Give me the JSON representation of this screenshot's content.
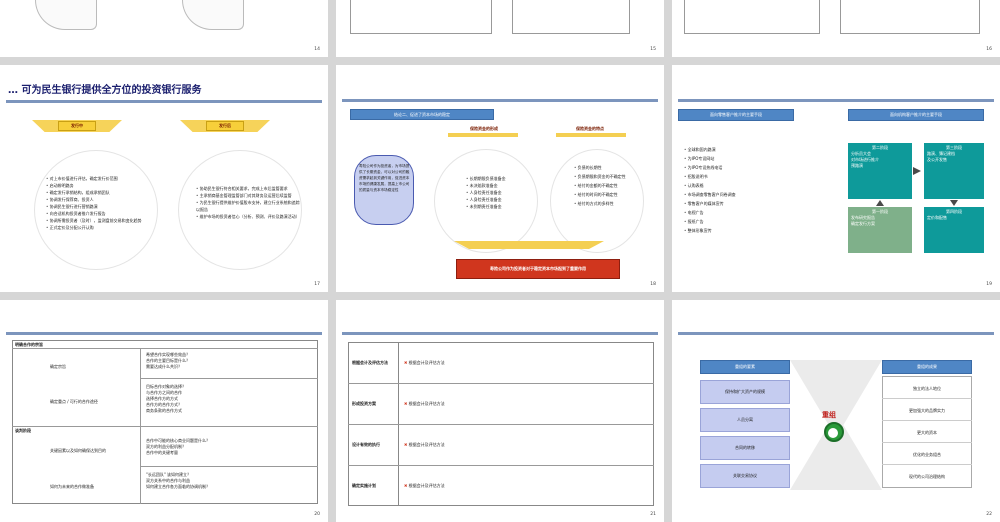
{
  "slides": {
    "s14": {
      "page": "14"
    },
    "s15": {
      "page": "15"
    },
    "s16": {
      "page": "16"
    },
    "s17": {
      "page": "17",
      "title": "… 可为民生银行提供全方位的投资银行服务",
      "stage_left": "发行中",
      "stage_right": "发行后",
      "left_items": [
        "对上市价值进行评估，确定发行价范围",
        "启动辨明路务",
        "确定发行承销结构，组成承销团队",
        "协调发行保荐商、投资人",
        "协调民生银行进行营销路演",
        "向合适机构投资者推介发行报告",
        "协调所需投资者（及时），监测盘前交易和变化趋势",
        "正式定价及分配公开认购"
      ],
      "right_items": [
        "协助民生银行符合相关要求，完成上市后监管要求",
        "主承销商基金管理监管部门对其财务及运营后续监管",
        "为民生银行提供维护价值股市支持，建立行业系统和追踪以报告",
        "维护市场的投资者信心（分析、预测、评价及路演活动）"
      ]
    },
    "s18": {
      "page": "18",
      "header": "结论二、促进了资本市场的稳定",
      "callout": "寿险公司作为投资者，为市场提供了长期资金，可以对公司的融资需求起到关键作用，促进资本市场的健康发展，提高上市公司的质量与资本市场稳定性",
      "left_head": "保险资金的形成",
      "right_head": "保险资金的特点",
      "left_items": [
        "长期期限负债准备金",
        "未决赔款准备金",
        "人身险责任准备金",
        "人身险责任准备金",
        "未到期责任准备金"
      ],
      "right_items": [
        "负债的长期性",
        "负债期限和资金的不确定性",
        "给付的金额的不确定性",
        "给付的时间的不确定性",
        "给付的方式的多样性"
      ],
      "bottom": "寿险公司作为投资者对于稳定资本市场起到了重要作用"
    },
    "s19": {
      "page": "19",
      "head_left": "面向零售客户推介的主要手段",
      "head_right": "面向机构客户推介的主要手段",
      "list": [
        "全球和国内路演",
        "为IPO专设网站",
        "为IPO专设热线电话",
        "招股说明书",
        "认购表格",
        "市场调查零售客户问卷调查",
        "零售客户的媒体宣传",
        "电视广告",
        "报纸广告",
        "整体形象宣传"
      ],
      "phases": [
        {
          "label": "第二阶段",
          "items": [
            "分析员大会",
            "对市场进行推介",
            "预路演"
          ]
        },
        {
          "label": "第三阶段",
          "items": [
            "路演、簿记建档",
            "及公开发售"
          ]
        },
        {
          "label": "第一阶段",
          "items": [
            "发布研究报告",
            "确定发行方案"
          ]
        },
        {
          "label": "第四阶段",
          "items": [
            "定价和配售"
          ]
        }
      ]
    },
    "s20": {
      "page": "20",
      "sec1": "明确合作的宗旨",
      "sec2": "谈判阶段",
      "rows": [
        {
          "label": "确定宗旨",
          "q": [
            "希望合作实现哪些效益？",
            "合作的主要目标是什么？",
            "需要达成什么共识？"
          ]
        },
        {
          "label": "确定重点 / 可行的合作途径",
          "q": [
            "目标合作对象的选择？",
            "与合作方之间的合作",
            "选择合作方的方式",
            "合作方的合作方式？",
            "商务条款的合作方式"
          ]
        },
        {
          "label": "关键因素以及如何确保达到目的",
          "q": [
            "合作中可能的核心商业问题是什么？",
            "双方的利益分配机制？",
            "合作中的关键考量"
          ]
        },
        {
          "label": "如何为未来的合作做准备",
          "q": [
            "\"长远团队\" 该如何建立？",
            "双方关系中的合作与利益",
            "如何建立合作各方面临的协调机制？"
          ]
        }
      ]
    },
    "s21": {
      "page": "21",
      "rows": [
        {
          "label": "根据会计及评估方法",
          "note": "根据会计及评估方法"
        },
        {
          "label": "形成投资方案",
          "note": "根据会计及评估方法"
        },
        {
          "label": "设计有效的执行",
          "note": "根据会计及评估方法"
        },
        {
          "label": "确定实施计划",
          "note": "根据会计及评估方法"
        }
      ]
    },
    "s22": {
      "page": "22",
      "head_left": "重组的要素",
      "head_right": "重组的成果",
      "center": "重组",
      "left": [
        "保持和扩大资产的规模",
        "人员分离",
        "合同的转移",
        "关联交易协议"
      ],
      "right": [
        "独立的法人地位",
        "更加强大的品牌实力",
        "更大的资本",
        "优化的业务组合",
        "现代的公司治理结构"
      ]
    }
  },
  "colors": {
    "accent": "#4f86c5",
    "bar": "#7c95bd",
    "banner": "#f7cf3a",
    "red": "#d0361e",
    "teal": "#0e9a9a",
    "green": "#7fb08a"
  }
}
